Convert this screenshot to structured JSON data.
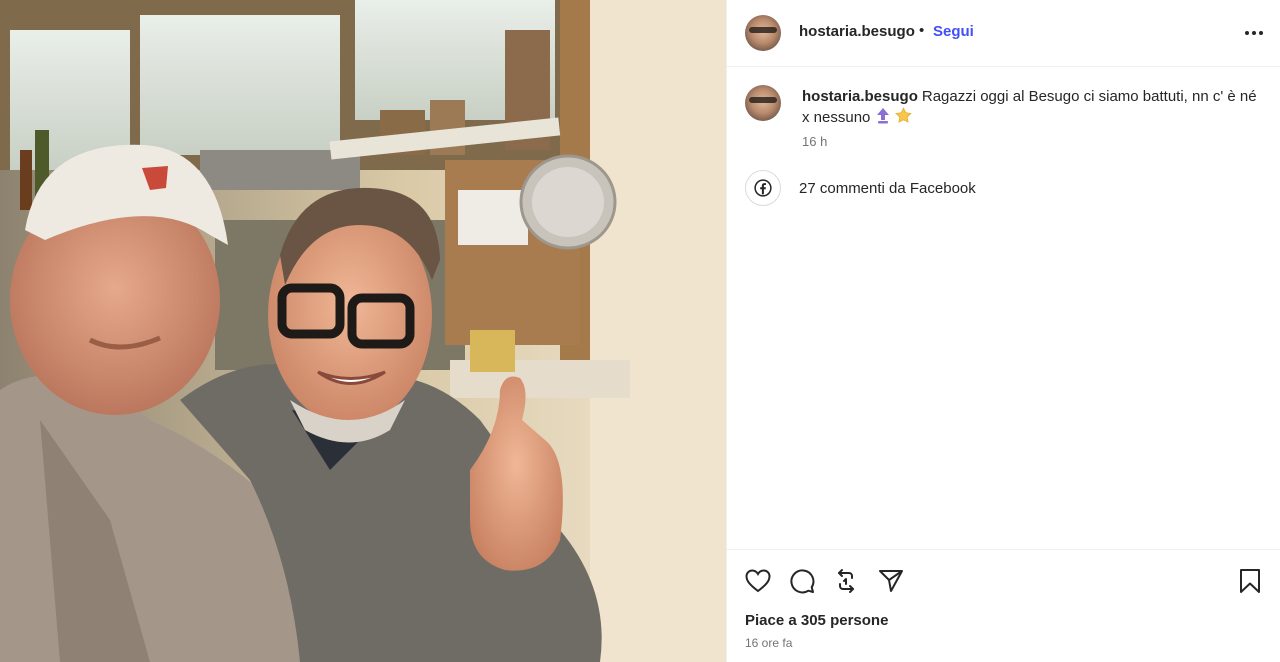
{
  "post": {
    "username": "hostaria.besugo",
    "separator": "•",
    "follow_label": "Segui",
    "more_icon": "more-horizontal-icon"
  },
  "caption": {
    "username": "hostaria.besugo",
    "text": "Ragazzi oggi al Besugo ci siamo battuti, nn c' è né x nessuno",
    "emojis": [
      "up-arrow-emoji",
      "star-emoji"
    ],
    "time": "16 h"
  },
  "facebook": {
    "icon": "facebook-icon",
    "label": "27 commenti da Facebook"
  },
  "actions": {
    "like_icon": "heart-icon",
    "comment_icon": "comment-icon",
    "repost_icon": "repost-icon",
    "share_icon": "send-icon",
    "save_icon": "bookmark-icon"
  },
  "likes_text": "Piace a 305 persone",
  "posted_ago": "16 ore fa",
  "colors": {
    "follow_blue": "#4150f7",
    "text": "#262626",
    "muted": "#737373",
    "divider": "#efefef"
  }
}
